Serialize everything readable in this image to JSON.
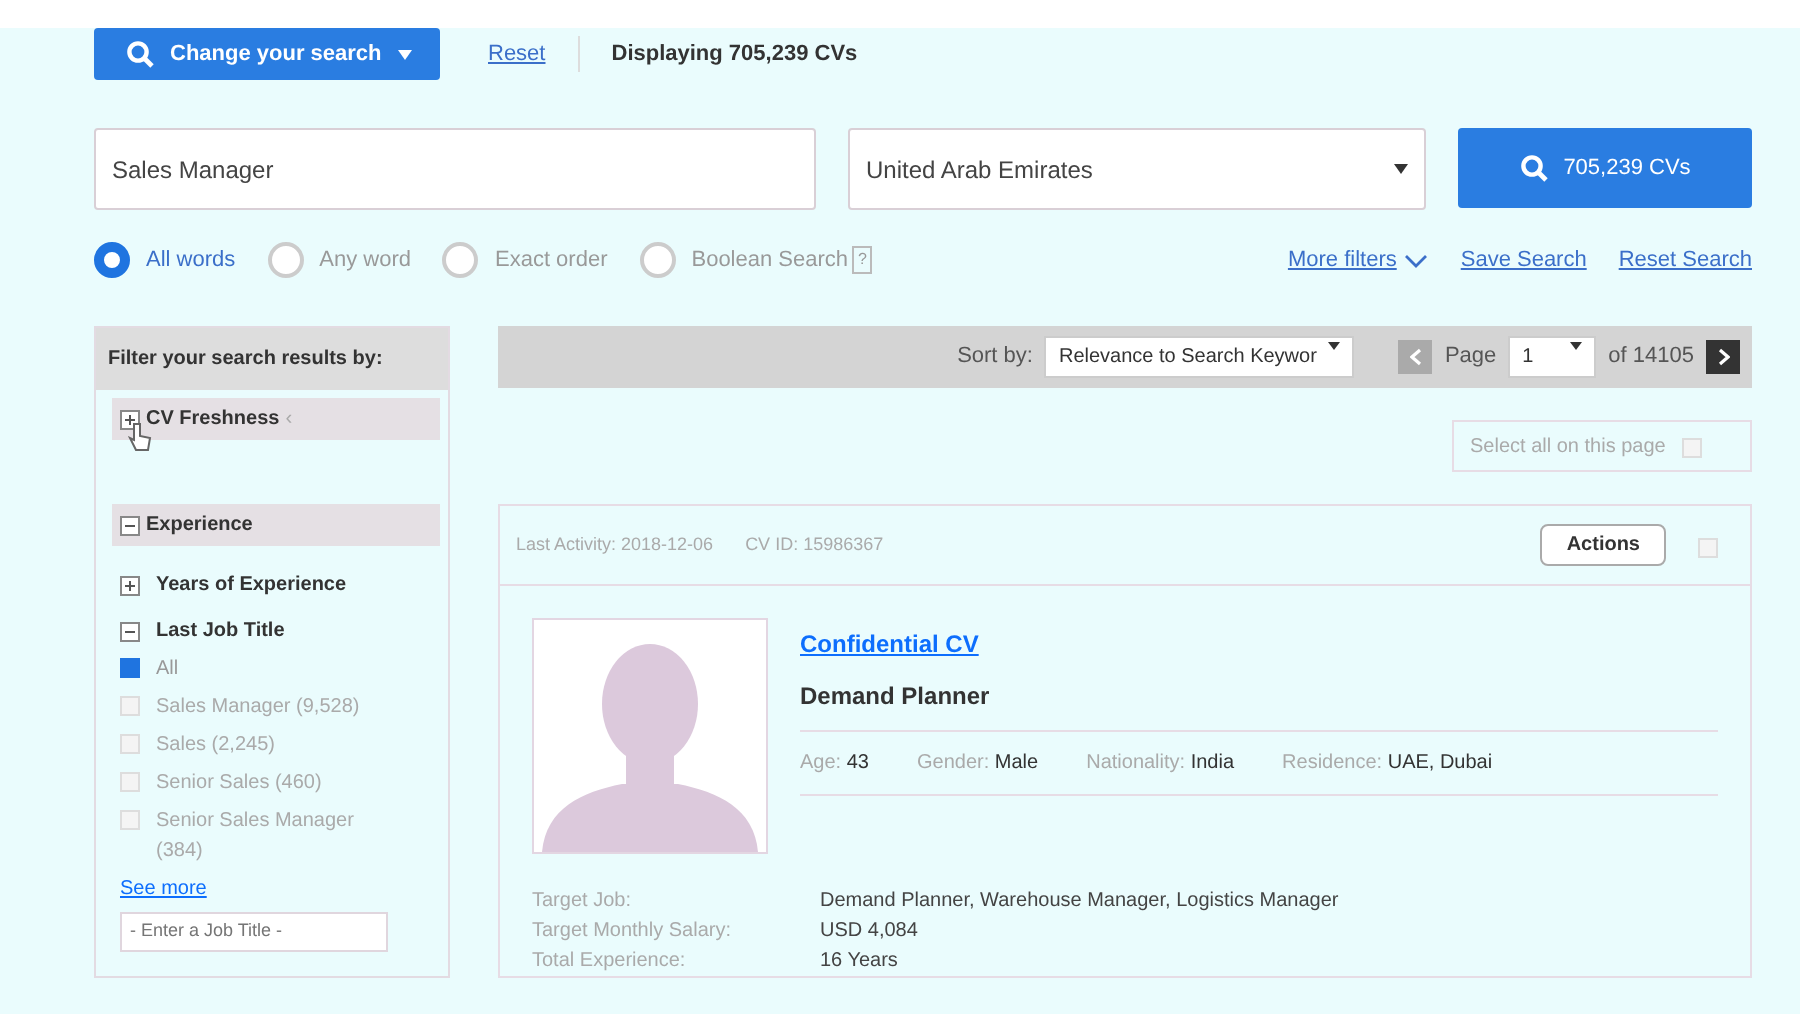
{
  "top_bar": {
    "change_button": "Change your search",
    "reset_link": "Reset",
    "displaying": "Displaying 705,239 CVs"
  },
  "search": {
    "keyword": "Sales Manager",
    "country": "United Arab Emirates",
    "search_button": "705,239 CVs"
  },
  "match_options": [
    {
      "label": "All words",
      "selected": true
    },
    {
      "label": "Any word",
      "selected": false
    },
    {
      "label": "Exact order",
      "selected": false
    },
    {
      "label": "Boolean Search",
      "selected": false,
      "help": "?"
    }
  ],
  "links": [
    "More filters",
    "Save Search",
    "Reset Search"
  ],
  "filters": {
    "title": "Filter your search results by:",
    "sections": [
      {
        "label": "CV Freshness",
        "expanded": false,
        "hint": "‹"
      },
      {
        "label": "Experience",
        "expanded": true,
        "children": [
          {
            "label": "Years of Experience",
            "expanded": false
          },
          {
            "label": "Last Job Title",
            "expanded": true,
            "options": [
              {
                "label": "All",
                "checked": true
              },
              {
                "label": "Sales Manager (9,528)",
                "checked": false
              },
              {
                "label": "Sales (2,245)",
                "checked": false
              },
              {
                "label": "Senior Sales (460)",
                "checked": false
              },
              {
                "label": "Senior Sales Manager (384)",
                "checked": false
              }
            ],
            "see_more": "See more",
            "placeholder": "- Enter a Job Title -"
          }
        ]
      }
    ]
  },
  "toolbar": {
    "sort_label": "Sort by:",
    "sort_value": "Relevance to Search Keywor",
    "page_label": "Page",
    "page": "1",
    "page_total": "of 14105",
    "prev_disabled": true
  },
  "select_all": {
    "label": "Select all on this page",
    "checked": false
  },
  "result": {
    "last_activity": "Last Activity: 2018-12-06",
    "cv_id": "CV ID: 15986367",
    "actions": "Actions",
    "checked": false,
    "name": "Confidential CV",
    "title": "Demand Planner",
    "facts": [
      {
        "label": "Age:",
        "value": "43"
      },
      {
        "label": "Gender:",
        "value": "Male"
      },
      {
        "label": "Nationality:",
        "value": "India"
      },
      {
        "label": "Residence:",
        "value": "UAE, Dubai"
      }
    ],
    "details": [
      {
        "label": "Target Job:",
        "value": "Demand Planner, Warehouse Manager, Logistics Manager"
      },
      {
        "label": "Target Monthly Salary:",
        "value": "USD 4,084"
      },
      {
        "label": "Total Experience:",
        "value": "16 Years"
      }
    ]
  }
}
